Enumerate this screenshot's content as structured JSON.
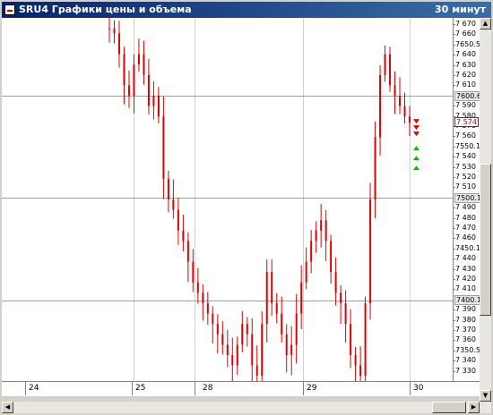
{
  "window": {
    "title": "SRU4 Графики цены и объема",
    "timeframe": "30 минут"
  },
  "price_axis": {
    "ticks": [
      "7 670",
      "7 660",
      "7650.50",
      "7 640",
      "7 630",
      "7 620",
      "7 610",
      "7600.61",
      "7 590",
      "7 580",
      "7 570",
      "7 560",
      "7550.12",
      "7 540",
      "7 530",
      "7 520",
      "7 510",
      "7500.18",
      "7 490",
      "7 480",
      "7 470",
      "7 460",
      "7450.10",
      "7 440",
      "7 430",
      "7 420",
      "7 410",
      "7400.12",
      "7 390",
      "7 380",
      "7 370",
      "7 360",
      "7350.56",
      "7 340",
      "7 330"
    ],
    "reference_lines": [
      "7600.61",
      "7500.18",
      "7400.12"
    ],
    "current_price": "7 574"
  },
  "date_axis": {
    "labels": [
      "24",
      "25",
      "28",
      "29",
      "30"
    ]
  },
  "chart_data": {
    "type": "bar",
    "series": [
      {
        "values": [
          7665,
          7660,
          7640,
          7610,
          7600,
          7630,
          7640,
          7620,
          7590,
          7600,
          7580,
          7520,
          7500,
          7490,
          7470,
          7460,
          7440,
          7420,
          7410,
          7400,
          7390,
          7380,
          7370,
          7360,
          7350,
          7340,
          7360,
          7380,
          7370,
          7340,
          7330,
          7380,
          7430,
          7400,
          7390,
          7370,
          7350,
          7360,
          7390,
          7420,
          7440,
          7460,
          7470,
          7480,
          7460,
          7430,
          7410,
          7400,
          7380,
          7350,
          7340,
          7330,
          7400,
          7500,
          7560,
          7620,
          7640,
          7610,
          7600,
          7590,
          7580,
          7574
        ]
      }
    ],
    "bar_style": "ohlc",
    "ylim": [
      7325,
      7675
    ],
    "signals": {
      "sell": 3,
      "buy": 3
    },
    "colors": {
      "bars": "#e00000",
      "sell": "#e00000",
      "buy": "#00c000",
      "grid": "#a0a0a0"
    }
  }
}
